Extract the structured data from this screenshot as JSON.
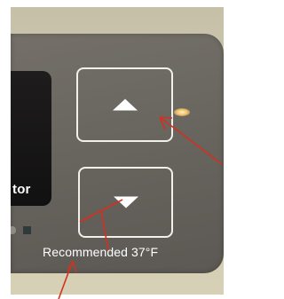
{
  "photo": {
    "display_text": "tor",
    "recommended_label": "Recommended 37°F"
  },
  "controls": {
    "up_button_icon": "triangle-up",
    "down_button_icon": "triangle-down"
  },
  "annotations": {
    "color": "#d43020",
    "count": 3
  },
  "colors": {
    "panel": "#6c6863",
    "display": "#161515",
    "button_outline": "#f2f0ea",
    "frame": "#cfc9b1"
  }
}
